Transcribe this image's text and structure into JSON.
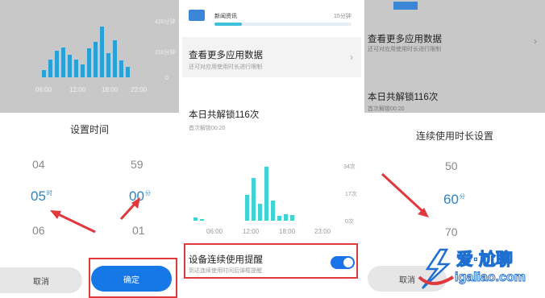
{
  "panel1": {
    "chart_data": {
      "type": "bar",
      "values": [
        0.12,
        0.3,
        0.45,
        0.5,
        0.38,
        0.3,
        0.22,
        0.48,
        0.6,
        0.85,
        0.4,
        0.62,
        0.28,
        0.18
      ],
      "x_tick_labels": [
        "06:00",
        "12:00",
        "18:00",
        "23:00"
      ],
      "ylabel_top": "420分钟",
      "ylabel_mid": "210分钟",
      "ylabel_zero": "0"
    },
    "dialog_title": "设置时间",
    "hour_above": "04",
    "hour_selected": "05",
    "hour_unit": "时",
    "hour_below": "06",
    "minute_above": "59",
    "minute_selected": "00",
    "minute_unit": "分",
    "minute_below": "01",
    "cancel_label": "取消",
    "confirm_label": "确定"
  },
  "panel2": {
    "app_name": "新闻资讯",
    "app_usage": "15分钟",
    "more_title": "查看更多应用数据",
    "more_sub": "还可对应用使用时长进行限制",
    "unlock_title": "本日共解锁116次",
    "unlock_sub": "首次解锁00:20",
    "chart_data": {
      "type": "bar",
      "values": [
        0.05,
        0.03,
        0.0,
        0.0,
        0.0,
        0.0,
        0.0,
        0.0,
        0.45,
        0.75,
        0.3,
        0.95,
        0.35,
        0.08,
        0.12,
        0.1
      ],
      "x_tick_labels": [
        "06:00",
        "12:00",
        "18:00",
        "23:00"
      ],
      "ylabel_top": "34次",
      "ylabel_mid": "17次",
      "ylabel_zero": "0次"
    },
    "reminder_title": "设备连续使用提醒",
    "reminder_sub": "到达连续使用时间后弹框提醒"
  },
  "panel3": {
    "more_title": "查看更多应用数据",
    "more_sub": "还可对应用使用时长进行限制",
    "unlock_title": "本日共解锁116次",
    "unlock_sub": "首次解锁00:20",
    "dialog_title": "连续使用时长设置",
    "above": "50",
    "selected": "60",
    "unit": "分",
    "below": "70",
    "cancel_label": "取消"
  },
  "watermark": {
    "line1": "爱·尬聊",
    "line2": "igaliao.com"
  },
  "colors": {
    "accent": "#1677e6",
    "bar_blue": "#2aa0d8",
    "bar_cyan": "#3ed4d4",
    "highlight_red": "#e0393d"
  }
}
